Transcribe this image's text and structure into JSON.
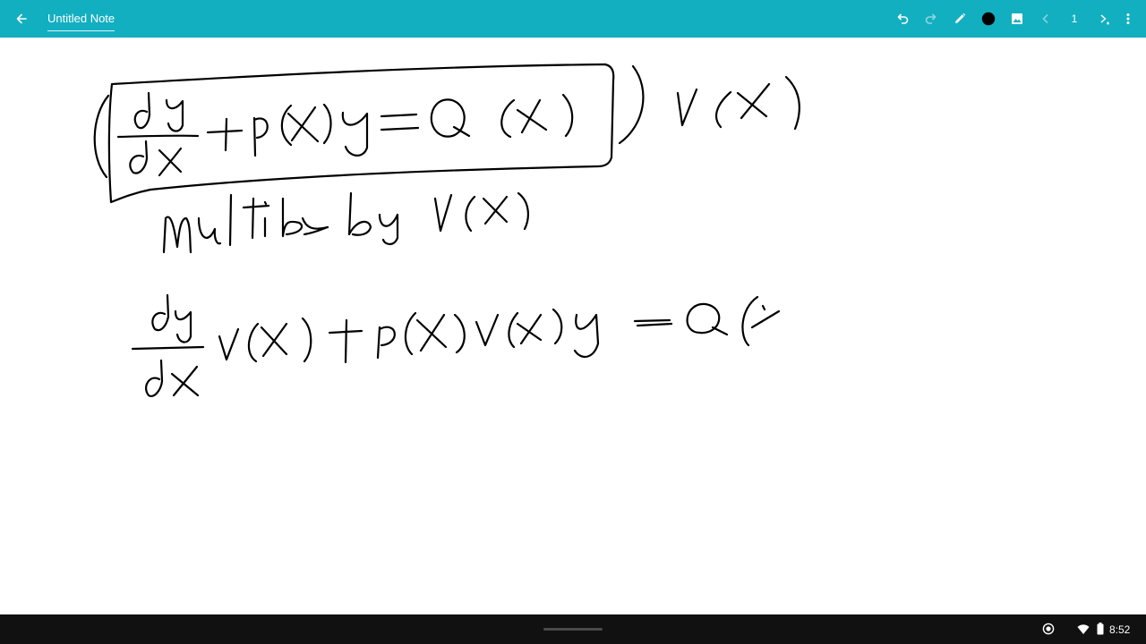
{
  "toolbar": {
    "title": "Untitled Note",
    "page_number": "1",
    "accent_color": "#12afc0",
    "pen_color": "#000000",
    "icons": [
      "back-arrow-icon",
      "undo-icon",
      "redo-icon",
      "pen-icon",
      "color-swatch-icon",
      "image-icon",
      "previous-page-icon",
      "next-page-icon",
      "more-vert-icon"
    ]
  },
  "canvas": {
    "background": "#ffffff",
    "ink_color": "#000000"
  },
  "status_bar": {
    "time": "8:52",
    "icons": [
      "screen-record-icon",
      "wifi-icon",
      "battery-icon"
    ]
  }
}
